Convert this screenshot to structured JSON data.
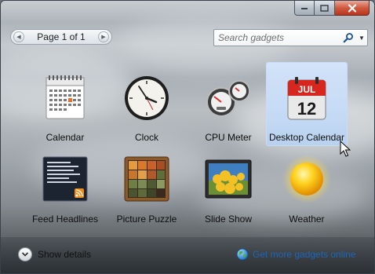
{
  "window": {
    "caption": {
      "minimize_glyph": "—",
      "maximize_glyph": "▢",
      "close_glyph": "✕"
    }
  },
  "pager": {
    "label": "Page 1 of 1",
    "prev_glyph": "◀",
    "next_glyph": "▶"
  },
  "search": {
    "placeholder": "Search gadgets",
    "value": "",
    "dropdown_glyph": "▼"
  },
  "gadgets": [
    {
      "label": "Calendar",
      "icon": "calendar-icon",
      "selected": false
    },
    {
      "label": "Clock",
      "icon": "clock-icon",
      "selected": false
    },
    {
      "label": "CPU Meter",
      "icon": "cpu-meter-icon",
      "selected": false
    },
    {
      "label": "Desktop Calendar",
      "icon": "desktop-calendar-icon",
      "selected": true,
      "month": "JUL",
      "day": "12"
    },
    {
      "label": "Feed Headlines",
      "icon": "feed-headlines-icon",
      "selected": false
    },
    {
      "label": "Picture Puzzle",
      "icon": "picture-puzzle-icon",
      "selected": false
    },
    {
      "label": "Slide Show",
      "icon": "slide-show-icon",
      "selected": false
    },
    {
      "label": "Weather",
      "icon": "weather-icon",
      "selected": false
    }
  ],
  "footer": {
    "show_details_label": "Show details",
    "more_gadgets_label": "Get more gadgets online"
  },
  "colors": {
    "link": "#1e66b8",
    "selection": "#c6dcf5",
    "close_button": "#c94a30"
  }
}
